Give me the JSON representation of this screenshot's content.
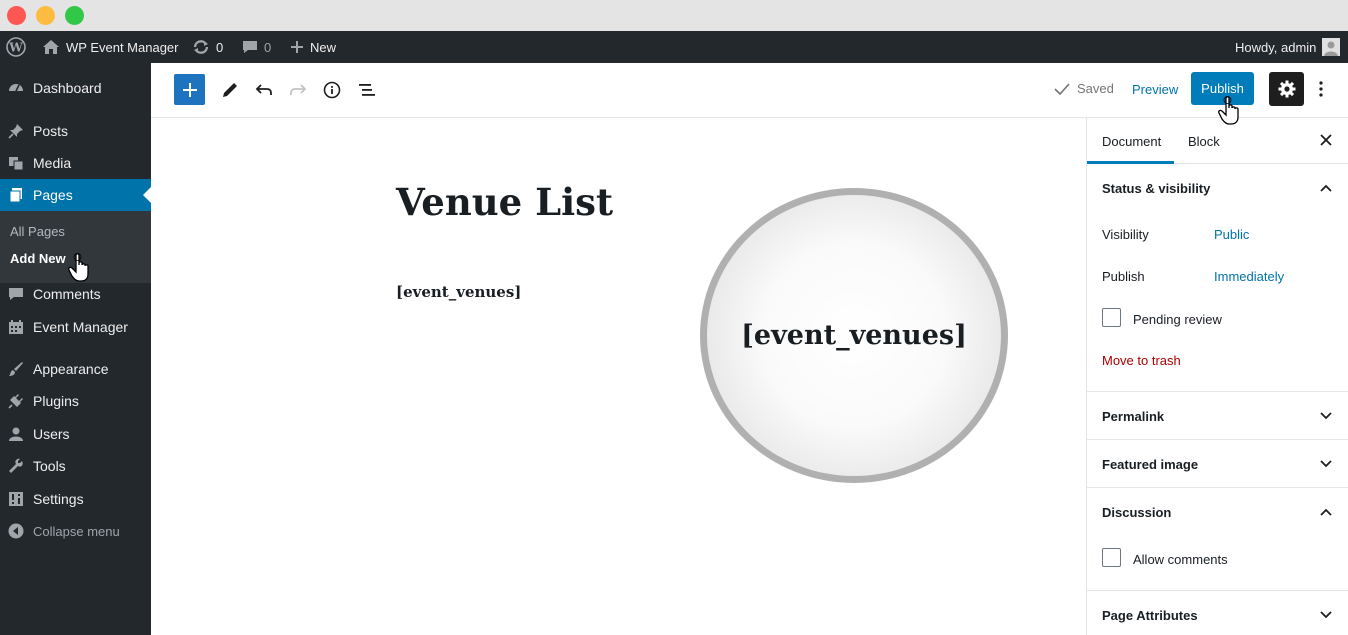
{
  "adminbar": {
    "site_name": "WP Event Manager",
    "updates_count": "0",
    "comments_count": "0",
    "new_label": "New",
    "howdy": "Howdy, admin"
  },
  "sidebar": {
    "items": [
      {
        "label": "Dashboard",
        "icon": "dashboard-icon"
      },
      {
        "label": "Posts",
        "icon": "pin-icon"
      },
      {
        "label": "Media",
        "icon": "media-icon"
      },
      {
        "label": "Pages",
        "icon": "pages-icon"
      },
      {
        "label": "Comments",
        "icon": "comment-icon"
      },
      {
        "label": "Event Manager",
        "icon": "calendar-icon"
      },
      {
        "label": "Appearance",
        "icon": "brush-icon"
      },
      {
        "label": "Plugins",
        "icon": "plugin-icon"
      },
      {
        "label": "Users",
        "icon": "user-icon"
      },
      {
        "label": "Tools",
        "icon": "wrench-icon"
      },
      {
        "label": "Settings",
        "icon": "settings-icon"
      }
    ],
    "submenu": [
      "All Pages",
      "Add New"
    ],
    "collapse_label": "Collapse menu"
  },
  "toolbar": {
    "saved_label": "Saved",
    "preview_label": "Preview",
    "publish_label": "Publish"
  },
  "editor": {
    "title": "Venue List",
    "shortcode": "[event_venues]",
    "magnified_text": "[event_venues]"
  },
  "panel": {
    "tab_document": "Document",
    "tab_block": "Block",
    "status_title": "Status & visibility",
    "visibility_label": "Visibility",
    "visibility_value": "Public",
    "publish_label": "Publish",
    "publish_value": "Immediately",
    "pending_review": "Pending review",
    "move_to_trash": "Move to trash",
    "permalink": "Permalink",
    "featured_image": "Featured image",
    "discussion": "Discussion",
    "allow_comments": "Allow comments",
    "page_attributes": "Page Attributes"
  },
  "colors": {
    "admin_dark": "#23282d",
    "accent_blue": "#007cba",
    "link_blue": "#0073aa",
    "danger_red": "#a00"
  }
}
